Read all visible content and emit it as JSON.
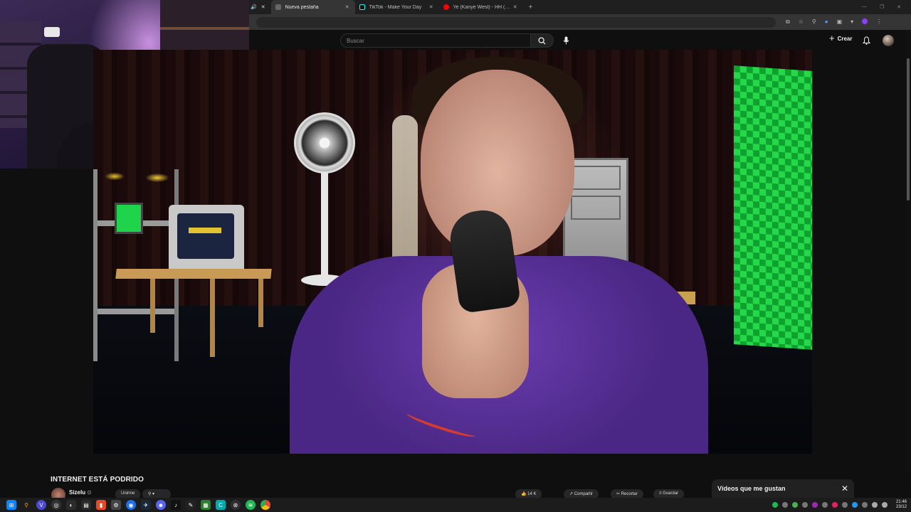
{
  "browser": {
    "tabs": [
      {
        "title": "Nueva pestaña",
        "active": true
      },
      {
        "title": "TikTok - Make Your Day",
        "active": false
      },
      {
        "title": "Ye (Kanye West) - HH (Happy I",
        "active": false
      }
    ],
    "new_tab_label": "+"
  },
  "youtube": {
    "search_placeholder": "Buscar",
    "create_label": "Crear",
    "video": {
      "title": "INTERNET ESTÁ PODRIDO",
      "channel": "Sizelu",
      "verified_mark": "⊙",
      "actions": [
        "Unirme",
        "14 K",
        "Compartir",
        "Recortar",
        "Guardar"
      ]
    },
    "liked_panel": {
      "title": "Vídeos que me gustan",
      "close": "✕"
    }
  },
  "taskbar": {
    "clock_time": "21:46",
    "clock_date": "23/12"
  },
  "colors": {
    "yt_background": "#0f0f0f",
    "shirt_purple": "#5a2f9a",
    "green_screen": "#25d84a",
    "spotify_green": "#1db954"
  }
}
